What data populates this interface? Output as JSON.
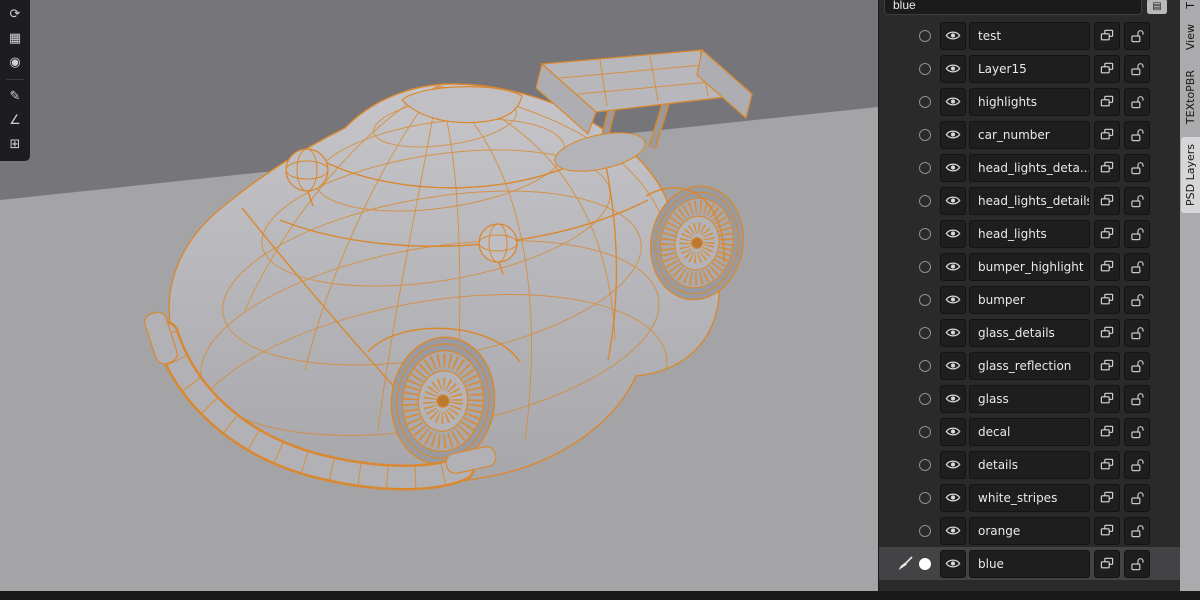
{
  "left_toolbar": {
    "tools": [
      {
        "name": "orbit-tool",
        "glyph": "⟳"
      },
      {
        "name": "image-tool",
        "glyph": "▦"
      },
      {
        "name": "matcap-tool",
        "glyph": "◉"
      },
      {
        "name": "brush-tool",
        "glyph": "✎"
      },
      {
        "name": "measure-tool",
        "glyph": "∠"
      },
      {
        "name": "annotate-tool",
        "glyph": "⊞"
      }
    ]
  },
  "right_panel": {
    "search": {
      "value": "blue",
      "action_glyph": "▤"
    },
    "layers": [
      {
        "name": "test",
        "selected": false
      },
      {
        "name": "Layer15",
        "selected": false
      },
      {
        "name": "highlights",
        "selected": false
      },
      {
        "name": "car_number",
        "selected": false
      },
      {
        "name": "head_lights_deta...",
        "selected": false
      },
      {
        "name": "head_lights_details",
        "selected": false
      },
      {
        "name": "head_lights",
        "selected": false
      },
      {
        "name": "bumper_highlight",
        "selected": false
      },
      {
        "name": "bumper",
        "selected": false
      },
      {
        "name": "glass_details",
        "selected": false
      },
      {
        "name": "glass_reflection",
        "selected": false
      },
      {
        "name": "glass",
        "selected": false
      },
      {
        "name": "decal",
        "selected": false
      },
      {
        "name": "details",
        "selected": false
      },
      {
        "name": "white_stripes",
        "selected": false
      },
      {
        "name": "orange",
        "selected": false
      },
      {
        "name": "blue",
        "selected": true
      }
    ]
  },
  "side_tabs": {
    "tabs": [
      {
        "label": "T",
        "active": false
      },
      {
        "label": "View",
        "active": false
      },
      {
        "label": "TEXtoPBR",
        "active": false
      },
      {
        "label": "PSD Layers",
        "active": true
      }
    ]
  },
  "colors": {
    "accent_orange": "#d9882f",
    "panel_bg": "#2a2a2b",
    "viewport_bg": "#76767a",
    "ground": "#a4a4a6",
    "car_gray": "#b5b5b9"
  }
}
